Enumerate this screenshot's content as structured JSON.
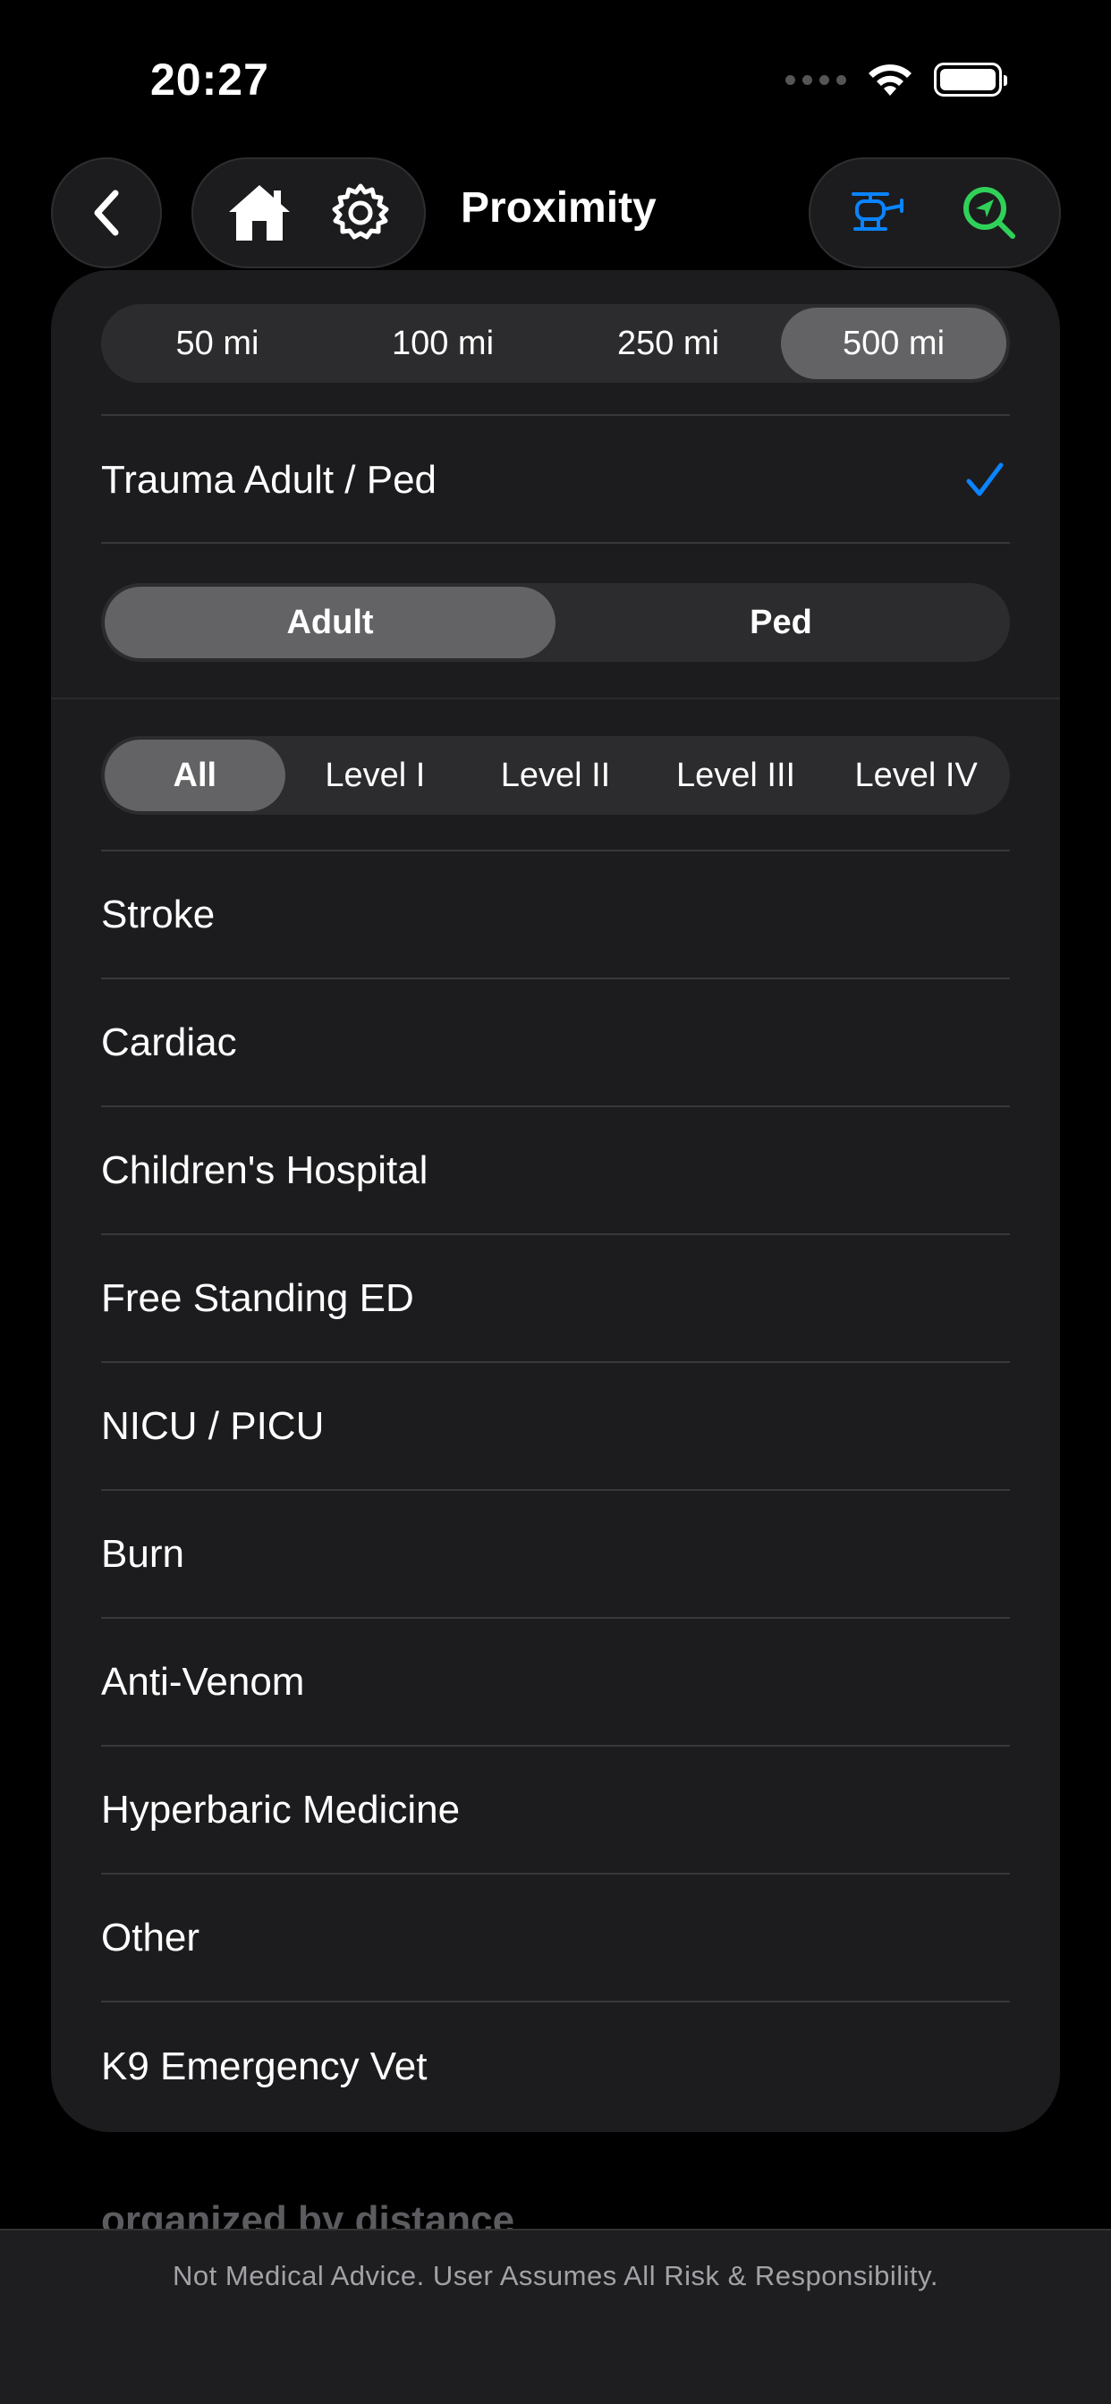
{
  "status_bar": {
    "time": "20:27"
  },
  "nav": {
    "title": "Proximity"
  },
  "distance": {
    "options": [
      "50 mi",
      "100 mi",
      "250 mi",
      "500 mi"
    ],
    "selected": "500 mi"
  },
  "trauma": {
    "label": "Trauma Adult / Ped",
    "checked": true,
    "age_options": [
      "Adult",
      "Ped"
    ],
    "age_selected": "Adult",
    "level_options": [
      "All",
      "Level I",
      "Level II",
      "Level III",
      "Level IV"
    ],
    "level_selected": "All"
  },
  "categories": [
    "Stroke",
    "Cardiac",
    "Children's Hospital",
    "Free Standing ED",
    "NICU / PICU",
    "Burn",
    "Anti-Venom",
    "Hyperbaric Medicine",
    "Other",
    "K9 Emergency Vet"
  ],
  "background": {
    "footer_heading": "organized by distance"
  },
  "footer": {
    "disclaimer": "Not Medical Advice. User Assumes All Risk & Responsibility."
  },
  "colors": {
    "check_blue": "#0a84ff",
    "helicopter_blue": "#0a84ff",
    "locate_green": "#30d158"
  }
}
